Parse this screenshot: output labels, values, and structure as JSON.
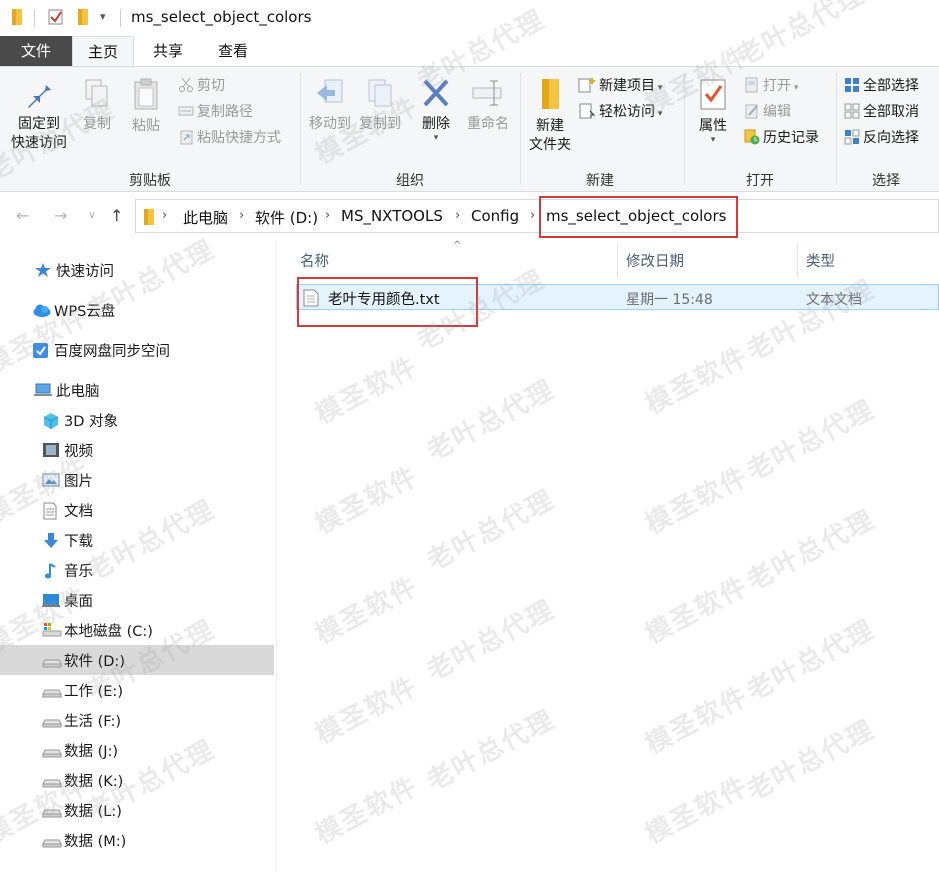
{
  "window": {
    "title": "ms_select_object_colors"
  },
  "ribbon_tabs": [
    {
      "label": "文件"
    },
    {
      "label": "主页"
    },
    {
      "label": "共享"
    },
    {
      "label": "查看"
    }
  ],
  "ribbon": {
    "clipboard": {
      "group_label": "剪贴板",
      "pin_line1": "固定到",
      "pin_line2": "快速访问",
      "copy": "复制",
      "paste": "粘贴",
      "cut": "剪切",
      "copy_path": "复制路径",
      "paste_shortcut": "粘贴快捷方式"
    },
    "organize": {
      "group_label": "组织",
      "move_to": "移动到",
      "copy_to": "复制到",
      "delete": "删除",
      "rename": "重命名"
    },
    "new": {
      "group_label": "新建",
      "new_folder_line1": "新建",
      "new_folder_line2": "文件夹",
      "new_item": "新建项目",
      "easy_access": "轻松访问"
    },
    "open": {
      "group_label": "打开",
      "properties": "属性",
      "open": "打开",
      "edit": "编辑",
      "history": "历史记录"
    },
    "select": {
      "group_label": "选择",
      "select_all": "全部选择",
      "select_none": "全部取消",
      "invert": "反向选择"
    }
  },
  "breadcrumb": [
    {
      "label": "此电脑"
    },
    {
      "label": "软件 (D:)"
    },
    {
      "label": "MS_NXTOOLS"
    },
    {
      "label": "Config"
    },
    {
      "label": "ms_select_object_colors"
    }
  ],
  "nav_pane": {
    "items": [
      {
        "label": "快速访问",
        "icon": "star-icon"
      },
      {
        "label": "WPS云盘",
        "icon": "cloud-icon"
      },
      {
        "label": "百度网盘同步空间",
        "icon": "baidu-sync-icon"
      },
      {
        "label": "此电脑",
        "icon": "computer-icon"
      },
      {
        "label": "3D 对象",
        "icon": "cube-icon"
      },
      {
        "label": "视频",
        "icon": "film-icon"
      },
      {
        "label": "图片",
        "icon": "picture-icon"
      },
      {
        "label": "文档",
        "icon": "document-icon"
      },
      {
        "label": "下载",
        "icon": "download-arrow-icon"
      },
      {
        "label": "音乐",
        "icon": "music-note-icon"
      },
      {
        "label": "桌面",
        "icon": "desktop-icon"
      },
      {
        "label": "本地磁盘 (C:)",
        "icon": "system-drive-icon"
      },
      {
        "label": "软件 (D:)",
        "icon": "drive-icon"
      },
      {
        "label": "工作 (E:)",
        "icon": "drive-icon"
      },
      {
        "label": "生活 (F:)",
        "icon": "drive-icon"
      },
      {
        "label": "数据 (J:)",
        "icon": "drive-icon"
      },
      {
        "label": "数据 (K:)",
        "icon": "drive-icon"
      },
      {
        "label": "数据 (L:)",
        "icon": "drive-icon"
      },
      {
        "label": "数据 (M:)",
        "icon": "drive-icon"
      }
    ],
    "selected": "软件 (D:)"
  },
  "file_list": {
    "columns": [
      "名称",
      "修改日期",
      "类型"
    ],
    "rows": [
      {
        "name": "老叶专用颜色.txt",
        "modified": "星期一 15:48",
        "type": "文本文档"
      }
    ]
  },
  "watermark": {
    "text_a": "模圣软件",
    "text_b": "老叶总代理"
  },
  "colors": {
    "highlight_box": "#d43a3a",
    "file_tab": "#4a4a4a",
    "selection_bg": "#e5f3ff"
  }
}
